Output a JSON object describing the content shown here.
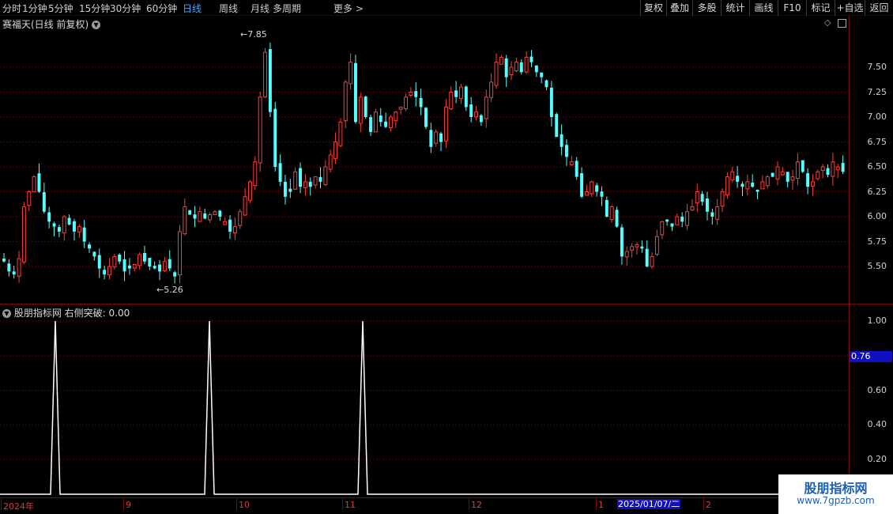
{
  "toolbar": {
    "periods": [
      "分时",
      "1分钟",
      "5分钟",
      "15分钟",
      "30分钟",
      "60分钟",
      "日线",
      "周线",
      "月线",
      "多周期",
      "更多 >"
    ],
    "active_period": "日线",
    "buttons": [
      "复权",
      "叠加",
      "多股",
      "统计",
      "画线",
      "F10",
      "标记",
      "+自选",
      "返回"
    ]
  },
  "main_chart": {
    "title": "赛福天(日线 前复权)",
    "high_label": "7.85",
    "low_label": "5.26",
    "price_ticks": [
      "7.50",
      "7.25",
      "7.00",
      "6.75",
      "6.50",
      "6.25",
      "6.00",
      "5.75",
      "5.50"
    ]
  },
  "indicator": {
    "title": "股朋指标网 右侧突破: 0.00",
    "ticks": [
      "1.00",
      "0.60",
      "0.40",
      "0.20"
    ],
    "current_value": "0.76"
  },
  "time_axis": {
    "labels": [
      "2024年",
      "9",
      "10",
      "11",
      "12",
      "1",
      "2"
    ],
    "selected_date": "2025/01/07/二"
  },
  "watermark": {
    "title": "股朋指标网",
    "url": "www.7gpzb.com"
  },
  "colors": {
    "up": "#ff3c3c",
    "down": "#54ffff",
    "grid": "#7a0a0a",
    "active": "#4aa3ff"
  },
  "chart_data": {
    "type": "candlestick",
    "title": "赛福天(日线 前复权)",
    "y_range": [
      5.26,
      7.85
    ],
    "closes": [
      5.55,
      5.45,
      5.42,
      5.58,
      6.1,
      6.25,
      6.4,
      6.25,
      6.05,
      5.95,
      5.9,
      5.85,
      6.0,
      5.92,
      5.85,
      5.9,
      5.75,
      5.68,
      5.6,
      5.48,
      5.42,
      5.5,
      5.6,
      5.55,
      5.45,
      5.48,
      5.52,
      5.62,
      5.55,
      5.5,
      5.48,
      5.45,
      5.55,
      5.48,
      5.4,
      5.85,
      6.1,
      6.02,
      5.98,
      6.05,
      5.98,
      6.02,
      6.05,
      6.0,
      5.95,
      5.85,
      5.9,
      6.05,
      6.2,
      6.35,
      6.55,
      7.2,
      7.65,
      7.05,
      6.5,
      6.35,
      6.2,
      6.25,
      6.45,
      6.3,
      6.35,
      6.3,
      6.4,
      6.35,
      6.5,
      6.62,
      6.75,
      6.95,
      7.35,
      7.55,
      6.95,
      7.2,
      7.0,
      6.85,
      7.05,
      6.95,
      6.9,
      7.0,
      7.05,
      7.1,
      7.2,
      7.25,
      7.2,
      7.1,
      6.9,
      6.7,
      6.85,
      6.75,
      7.1,
      7.25,
      7.2,
      7.3,
      7.1,
      7.0,
      7.05,
      6.95,
      7.2,
      7.35,
      7.55,
      7.6,
      7.4,
      7.5,
      7.55,
      7.45,
      7.6,
      7.55,
      7.45,
      7.4,
      7.3,
      7.0,
      6.8,
      6.7,
      6.6,
      6.55,
      6.4,
      6.2,
      6.25,
      6.35,
      6.25,
      6.2,
      6.0,
      6.1,
      5.9,
      5.6,
      5.65,
      5.7,
      5.72,
      5.68,
      5.5,
      5.6,
      5.8,
      5.95,
      5.95,
      5.9,
      6.0,
      5.95,
      6.05,
      6.1,
      6.25,
      6.15,
      6.05,
      6.0,
      6.1,
      6.25,
      6.4,
      6.45,
      6.35,
      6.3,
      6.35,
      6.3,
      6.25,
      6.35,
      6.4,
      6.4,
      6.5,
      6.45,
      6.35,
      6.4,
      6.55,
      6.45,
      6.3,
      6.35,
      6.45,
      6.5,
      6.42,
      6.55,
      6.5,
      6.45
    ],
    "indicator_series": {
      "name": "右侧突破",
      "peaks_at_index": [
        10,
        36,
        62
      ],
      "values": "0 or 1"
    }
  }
}
